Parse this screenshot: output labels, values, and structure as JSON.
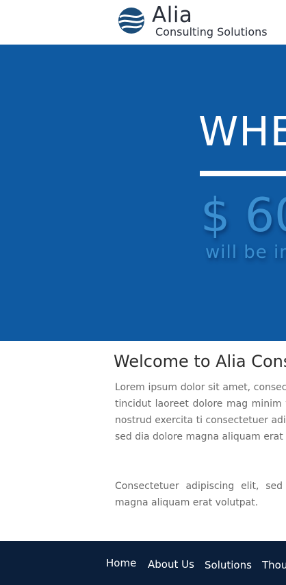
{
  "brand": {
    "name": "Alia",
    "tagline": "Consulting Solutions",
    "colors": {
      "primary": "#0f5aa2",
      "accent": "#3b8fd0",
      "footer": "#0b1f3b"
    }
  },
  "hero": {
    "heading": "WHE",
    "amount": "$ 60",
    "subtext": "will be inv"
  },
  "content": {
    "title": "Welcome to Alia Cons",
    "paragraph1": "Lorem ipsum dolor sit amet, consecte euismod tincidut laoreet dolore mag minim veniamquis nostrud exercita ti consectetuer adipiscing elit, sed dia dolore magna aliquam erat volutpat.",
    "paragraph2": "Consectetuer adipiscing elit, sed dia dolore magna aliquam erat volutpat."
  },
  "nav": {
    "items": [
      {
        "label": "Home"
      },
      {
        "label": "About Us"
      },
      {
        "label": "Solutions"
      },
      {
        "label": "Thou"
      }
    ]
  }
}
